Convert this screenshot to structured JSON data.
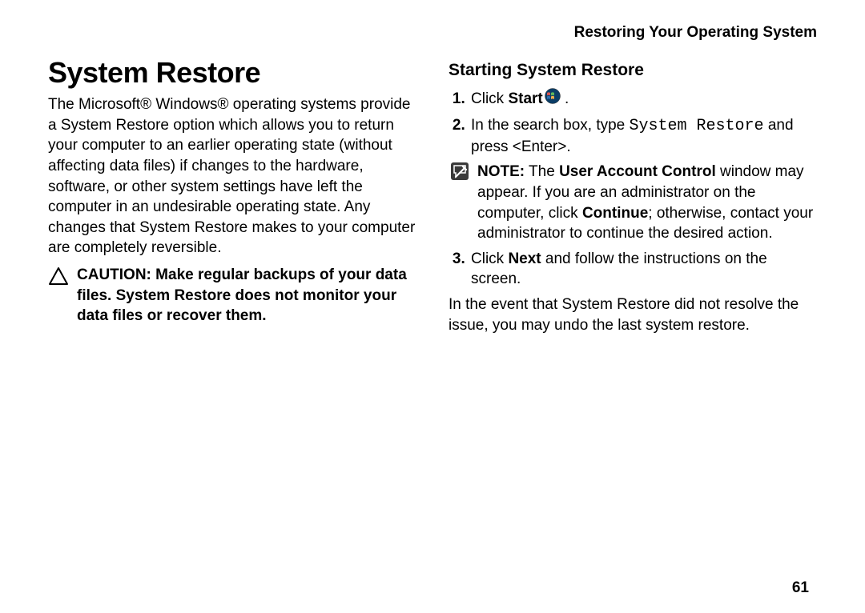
{
  "header": "Restoring Your Operating System",
  "page_number": "61",
  "left": {
    "title": "System Restore",
    "intro": "The Microsoft® Windows® operating systems provide a System Restore option which allows you to return your computer to an earlier operating state (without affecting data files) if changes to the hardware, software, or other system settings have left the computer in an undesirable operating state. Any changes that System Restore makes to your computer are completely reversible.",
    "caution_label": "CAUTION:",
    "caution_body": "Make regular backups of your data files. System Restore does not monitor your data files or recover them."
  },
  "right": {
    "subtitle": "Starting System Restore",
    "step1_a": "Click ",
    "step1_b": "Start",
    "step1_c": " .",
    "step2_a": "In the search box, type ",
    "step2_code": "System Restore",
    "step2_b": " and press <Enter>.",
    "note_label": "NOTE:",
    "note_a": "The ",
    "note_b": "User Account Control",
    "note_c": " window may appear. If you are an administrator on the computer, click ",
    "note_d": "Continue",
    "note_e": "; otherwise, contact your administrator to continue the desired action.",
    "step3_a": "Click ",
    "step3_b": "Next",
    "step3_c": " and follow the instructions on the screen.",
    "closing": "In the event that System Restore did not resolve the issue, you may undo the last system restore."
  }
}
